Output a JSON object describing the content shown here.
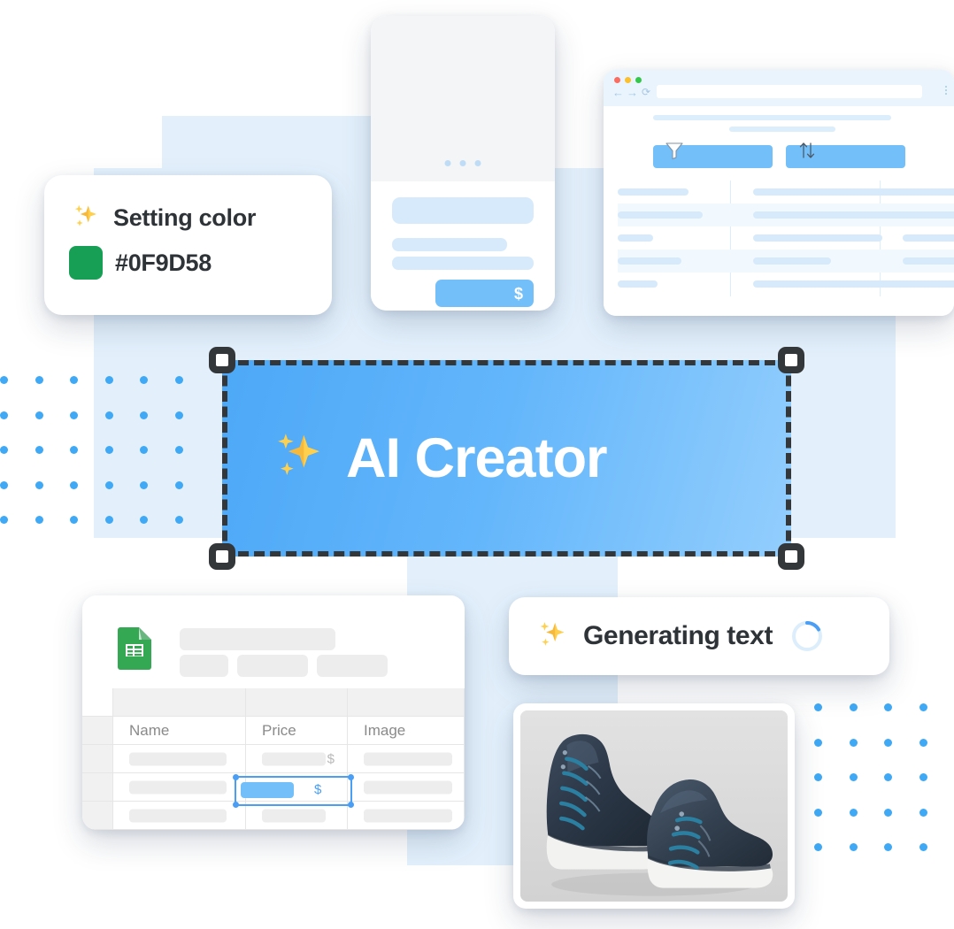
{
  "setting_color_card": {
    "icon": "sparkles-icon",
    "title": "Setting color",
    "swatch_icon": "color-swatch",
    "color_value": "#0F9D58",
    "swatch_hex": "#17A055"
  },
  "ai_banner": {
    "icon": "sparkles-icon",
    "label": "AI Creator",
    "gradient_from": "#4DA8F7",
    "gradient_to": "#93CEFD",
    "handle_color": "#333739",
    "selected": true
  },
  "generating_card": {
    "icon": "sparkles-icon",
    "label": "Generating text",
    "spinner_icon": "loading-spinner",
    "spinner_color": "#4A9FF5"
  },
  "phone_mockup": {
    "carousel_dots": 3,
    "price_button_symbol": "$",
    "accent": "#73BFFA"
  },
  "browser_window": {
    "traffic_lights": [
      "#FC6D61",
      "#FCC02D",
      "#34C84A"
    ],
    "nav": {
      "back_icon": "arrow-left-icon",
      "back_glyph": "←",
      "forward_icon": "arrow-right-icon",
      "forward_glyph": "→",
      "reload_icon": "reload-icon",
      "reload_glyph": "⟳"
    },
    "url_value": "",
    "menu_icon": "kebab-menu-icon",
    "filter_button": {
      "icon": "filter-funnel-icon",
      "label": ""
    },
    "sort_button": {
      "icon": "sort-arrows-icon",
      "label": ""
    },
    "rows": [
      {
        "alt": false,
        "widths": [
          80,
          244,
          63
        ]
      },
      {
        "alt": true,
        "widths": [
          96,
          264,
          63
        ]
      },
      {
        "alt": false,
        "widths": [
          40,
          146,
          63
        ]
      },
      {
        "alt": true,
        "widths": [
          72,
          88,
          63
        ]
      },
      {
        "alt": false,
        "widths": [
          45,
          235,
          63
        ]
      }
    ]
  },
  "sheet_card": {
    "app_icon": "google-sheets-icon",
    "columns": [
      "Name",
      "Price",
      "Image"
    ],
    "rows": [
      {
        "name": "",
        "price": "",
        "price_symbol": "$",
        "image": "",
        "selected": false
      },
      {
        "name": "",
        "price": "",
        "price_symbol": "$",
        "image": "",
        "selected": true
      },
      {
        "name": "",
        "price": "",
        "price_symbol": "",
        "image": "",
        "selected": false
      }
    ],
    "selection_color": "#4A9FF5",
    "selected_fill": "#73BFFA"
  },
  "shoe_card": {
    "image_alt": "navy-blue-high-top-sneakers-product-photo"
  },
  "decor": {
    "dot_color": "#3FA9F5",
    "panel_color": "#E3F0FC",
    "dotgrid_left": {
      "cols": 6,
      "rows": 5
    },
    "dotgrid_right": {
      "cols": 4,
      "rows": 5
    }
  }
}
